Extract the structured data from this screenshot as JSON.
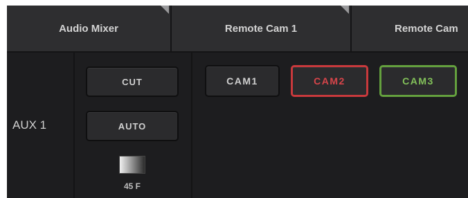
{
  "tabs": [
    {
      "label": "Audio Mixer"
    },
    {
      "label": "Remote Cam 1"
    },
    {
      "label": "Remote Cam"
    }
  ],
  "row": {
    "label": "AUX 1"
  },
  "transition": {
    "cut_label": "CUT",
    "auto_label": "AUTO",
    "duration": "45 F"
  },
  "cameras": [
    {
      "label": "CAM1",
      "state": "off"
    },
    {
      "label": "CAM2",
      "state": "program",
      "color": "#c8393c"
    },
    {
      "label": "CAM3",
      "state": "preview",
      "color": "#64a03e"
    }
  ]
}
